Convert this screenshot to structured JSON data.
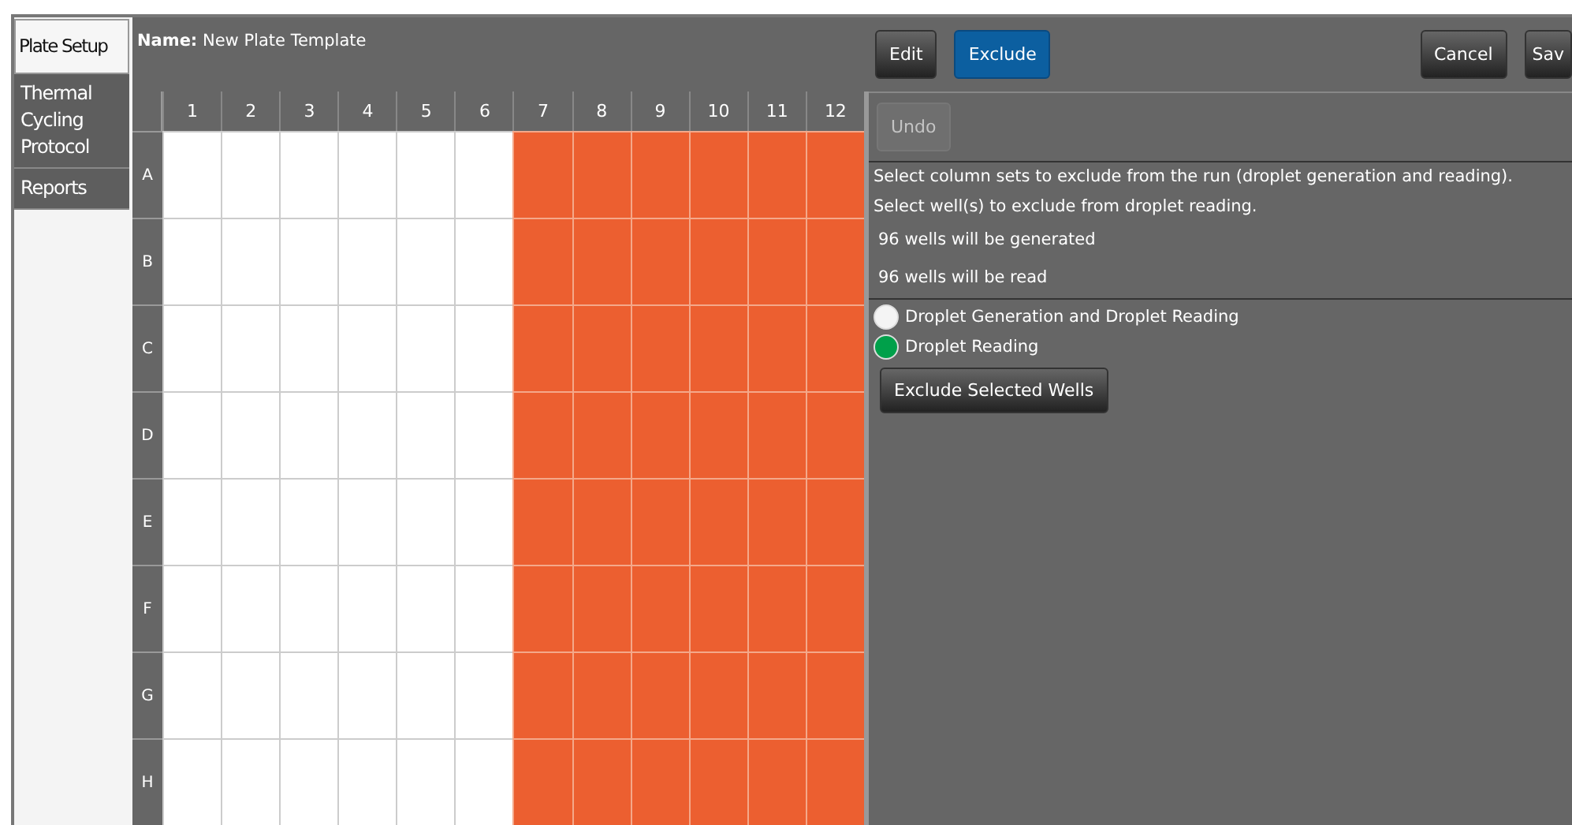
{
  "sidebar": {
    "tabs": [
      {
        "label": "Plate Setup",
        "selected": true
      },
      {
        "label": "Thermal Cycling Protocol",
        "selected": false
      },
      {
        "label": "Reports",
        "selected": false
      }
    ]
  },
  "plate": {
    "name_label": "Name:",
    "name": "New Plate Template",
    "columns": [
      "1",
      "2",
      "3",
      "4",
      "5",
      "6",
      "7",
      "8",
      "9",
      "10",
      "11",
      "12"
    ],
    "rows": [
      {
        "label": "A",
        "wells": [
          false,
          false,
          false,
          false,
          false,
          false,
          true,
          true,
          true,
          true,
          true,
          true
        ]
      },
      {
        "label": "B",
        "wells": [
          false,
          false,
          false,
          false,
          false,
          false,
          true,
          true,
          true,
          true,
          true,
          true
        ]
      },
      {
        "label": "C",
        "wells": [
          false,
          false,
          false,
          false,
          false,
          false,
          true,
          true,
          true,
          true,
          true,
          true
        ]
      },
      {
        "label": "D",
        "wells": [
          false,
          false,
          false,
          false,
          false,
          false,
          true,
          true,
          true,
          true,
          true,
          true
        ]
      },
      {
        "label": "E",
        "wells": [
          false,
          false,
          false,
          false,
          false,
          false,
          true,
          true,
          true,
          true,
          true,
          true
        ]
      },
      {
        "label": "F",
        "wells": [
          false,
          false,
          false,
          false,
          false,
          false,
          true,
          true,
          true,
          true,
          true,
          true
        ]
      },
      {
        "label": "G",
        "wells": [
          false,
          false,
          false,
          false,
          false,
          false,
          true,
          true,
          true,
          true,
          true,
          true
        ]
      },
      {
        "label": "H",
        "wells": [
          false,
          false,
          false,
          false,
          false,
          false,
          true,
          true,
          true,
          true,
          true,
          true
        ]
      }
    ]
  },
  "mode_buttons": [
    {
      "label": "Edit",
      "selected": false
    },
    {
      "label": "Exclude",
      "selected": true
    }
  ],
  "action_buttons": [
    "Cancel",
    "Sav"
  ],
  "undo": {
    "label": "Undo",
    "disabled": true
  },
  "instructions": [
    "Select column sets to exclude from the run (droplet generation and reading).",
    "Select well(s) to exclude from droplet reading."
  ],
  "counts": [
    "96 wells will be generated",
    "96 wells will be read"
  ],
  "legend": [
    {
      "label": "Droplet Generation and Droplet Reading",
      "color": "#f4f4f4"
    },
    {
      "label": "Droplet Reading",
      "color": "#00a04a"
    }
  ],
  "exclude_button": "Exclude Selected Wells"
}
